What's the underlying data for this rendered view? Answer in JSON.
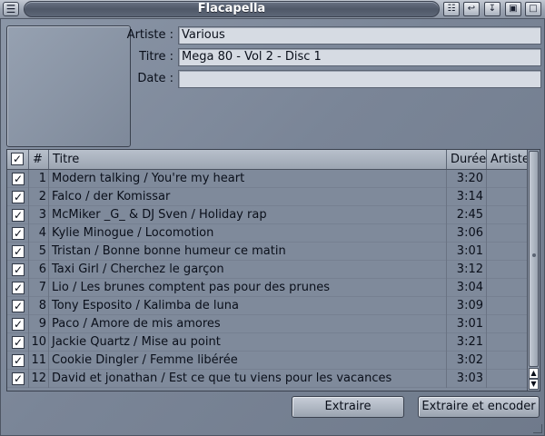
{
  "window": {
    "title": "Flacapella",
    "left_button_icon": "menu-icon",
    "right_button_icons": [
      "iconify-icon",
      "depth-icon",
      "snapshot-icon",
      "zoom-icon",
      "close-icon"
    ]
  },
  "form": {
    "artiste_label": "Artiste :",
    "artiste_value": "Various",
    "titre_label": "Titre :",
    "titre_value": "Mega 80 - Vol 2 - Disc 1",
    "date_label": "Date :",
    "date_value": ""
  },
  "table": {
    "headers": {
      "check": "✓",
      "number": "#",
      "titre": "Titre",
      "duree": "Durée",
      "artiste": "Artiste"
    },
    "tracks": [
      {
        "checked": true,
        "n": "1",
        "titre": "Modern talking / You're my heart",
        "duree": "3:20",
        "artiste": ""
      },
      {
        "checked": true,
        "n": "2",
        "titre": "Falco / der Komissar",
        "duree": "3:14",
        "artiste": ""
      },
      {
        "checked": true,
        "n": "3",
        "titre": "McMiker _G_ & DJ Sven / Holiday rap",
        "duree": "2:45",
        "artiste": ""
      },
      {
        "checked": true,
        "n": "4",
        "titre": "Kylie Minogue / Locomotion",
        "duree": "3:06",
        "artiste": ""
      },
      {
        "checked": true,
        "n": "5",
        "titre": "Tristan / Bonne bonne humeur ce matin",
        "duree": "3:01",
        "artiste": ""
      },
      {
        "checked": true,
        "n": "6",
        "titre": "Taxi Girl / Cherchez le garçon",
        "duree": "3:12",
        "artiste": ""
      },
      {
        "checked": true,
        "n": "7",
        "titre": "Lio / Les brunes comptent pas pour des prunes",
        "duree": "3:04",
        "artiste": ""
      },
      {
        "checked": true,
        "n": "8",
        "titre": "Tony Esposito / Kalimba de luna",
        "duree": "3:09",
        "artiste": ""
      },
      {
        "checked": true,
        "n": "9",
        "titre": "Paco / Amore de mis amores",
        "duree": "3:01",
        "artiste": ""
      },
      {
        "checked": true,
        "n": "10",
        "titre": "Jackie Quartz / Mise au point",
        "duree": "3:21",
        "artiste": ""
      },
      {
        "checked": true,
        "n": "11",
        "titre": "Cookie Dingler / Femme libérée",
        "duree": "3:02",
        "artiste": ""
      },
      {
        "checked": true,
        "n": "12",
        "titre": "David et jonathan / Est ce que tu viens pour les vacances",
        "duree": "3:03",
        "artiste": ""
      }
    ]
  },
  "buttons": {
    "extraire": "Extraire",
    "extraire_encoder": "Extraire et encoder"
  }
}
